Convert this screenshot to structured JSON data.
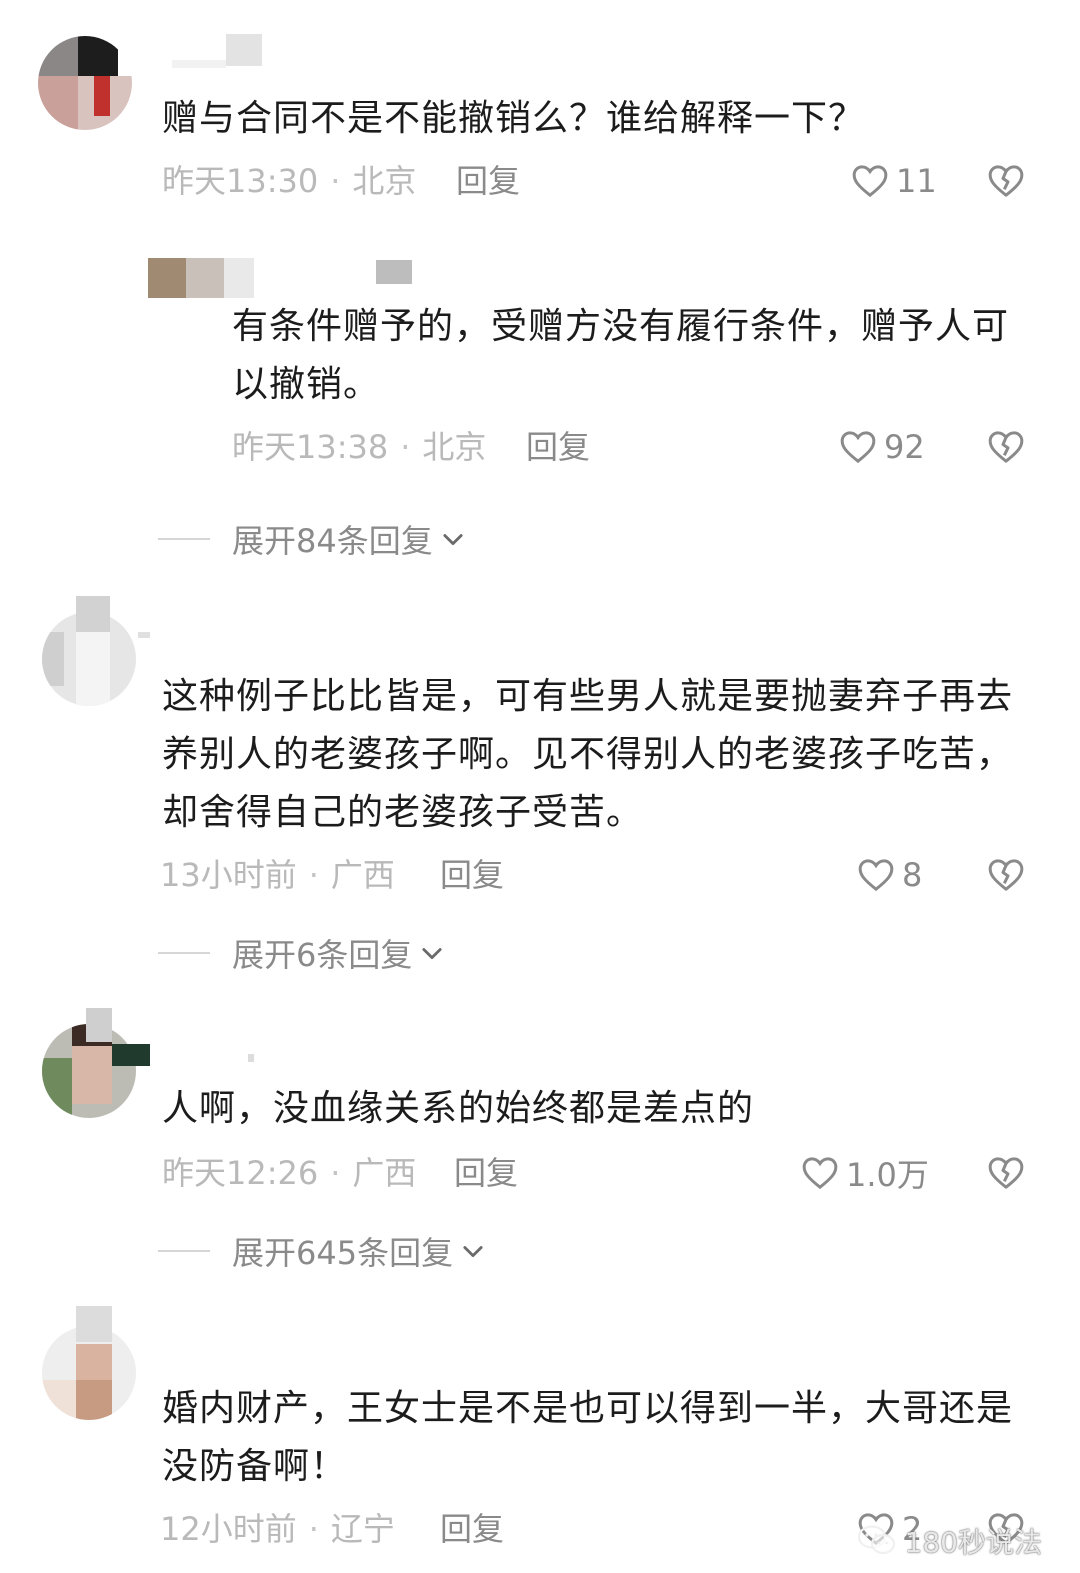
{
  "comments": [
    {
      "text": "赠与合同不是不能撤销么？谁给解释一下？",
      "time": "昨天13:30",
      "location": "北京",
      "reply_label": "回复",
      "likes": "11",
      "reply": {
        "text": "有条件赠予的，受赠方没有履行条件，赠予人可以撤销。",
        "time": "昨天13:38",
        "location": "北京",
        "reply_label": "回复",
        "likes": "92"
      },
      "expand_label": "展开84条回复"
    },
    {
      "text": "这种例子比比皆是，可有些男人就是要抛妻弃子再去养别人的老婆孩子啊。见不得别人的老婆孩子吃苦，却舍得自己的老婆孩子受苦。",
      "time": "13小时前",
      "location": "广西",
      "reply_label": "回复",
      "likes": "8",
      "expand_label": "展开6条回复"
    },
    {
      "text": "人啊，没血缘关系的始终都是差点的",
      "time": "昨天12:26",
      "location": "广西",
      "reply_label": "回复",
      "likes": "1.0万",
      "expand_label": "展开645条回复"
    },
    {
      "text": "婚内财产，王女士是不是也可以得到一半，大哥还是没防备啊！",
      "time": "12小时前",
      "location": "辽宁",
      "reply_label": "回复",
      "likes": "2"
    }
  ],
  "meta_separator": "·",
  "watermark": "180秒说法",
  "icons": {
    "like": "heart-outline-icon",
    "dislike": "broken-heart-icon",
    "expand": "chevron-down-icon",
    "watermark": "wechat-icon"
  },
  "colors": {
    "text": "#1c1c1c",
    "meta": "#b9b9b9",
    "action": "#8a8a8a",
    "background": "#ffffff"
  }
}
